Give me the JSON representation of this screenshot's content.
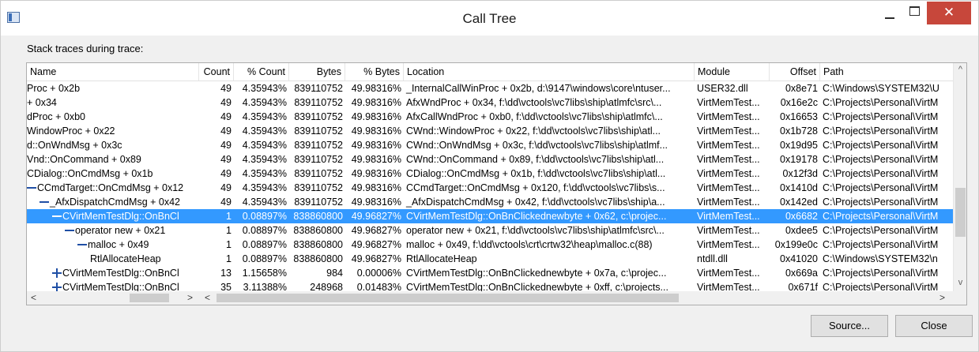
{
  "window": {
    "title": "Call Tree",
    "close_glyph": "✕"
  },
  "caption": "Stack traces during trace:",
  "columns": {
    "name": "Name",
    "count": "Count",
    "pct_count": "% Count",
    "bytes": "Bytes",
    "pct_bytes": "% Bytes",
    "location": "Location",
    "module": "Module",
    "offset": "Offset",
    "path": "Path"
  },
  "rows": [
    {
      "name": "Proc + 0x2b",
      "level": 0,
      "expander": "",
      "count": "49",
      "pct_count": "4.35943%",
      "bytes": "839110752",
      "pct_bytes": "49.98316%",
      "location": "_InternalCallWinProc + 0x2b, d:\\9147\\windows\\core\\ntuser...",
      "module": "USER32.dll",
      "offset": "0x8e71",
      "path": "C:\\Windows\\SYSTEM32\\U"
    },
    {
      "name": "+ 0x34",
      "level": 0,
      "expander": "",
      "count": "49",
      "pct_count": "4.35943%",
      "bytes": "839110752",
      "pct_bytes": "49.98316%",
      "location": "AfxWndProc + 0x34, f:\\dd\\vctools\\vc7libs\\ship\\atlmfc\\src\\...",
      "module": "VirtMemTest...",
      "offset": "0x16e2c",
      "path": "C:\\Projects\\Personal\\VirtM"
    },
    {
      "name": "dProc + 0xb0",
      "level": 0,
      "expander": "",
      "count": "49",
      "pct_count": "4.35943%",
      "bytes": "839110752",
      "pct_bytes": "49.98316%",
      "location": "AfxCallWndProc + 0xb0, f:\\dd\\vctools\\vc7libs\\ship\\atlmfc\\...",
      "module": "VirtMemTest...",
      "offset": "0x16653",
      "path": "C:\\Projects\\Personal\\VirtM"
    },
    {
      "name": "WindowProc + 0x22",
      "level": 0,
      "expander": "",
      "count": "49",
      "pct_count": "4.35943%",
      "bytes": "839110752",
      "pct_bytes": "49.98316%",
      "location": "CWnd::WindowProc + 0x22, f:\\dd\\vctools\\vc7libs\\ship\\atl...",
      "module": "VirtMemTest...",
      "offset": "0x1b728",
      "path": "C:\\Projects\\Personal\\VirtM"
    },
    {
      "name": "d::OnWndMsg + 0x3c",
      "level": 0,
      "expander": "",
      "count": "49",
      "pct_count": "4.35943%",
      "bytes": "839110752",
      "pct_bytes": "49.98316%",
      "location": "CWnd::OnWndMsg + 0x3c, f:\\dd\\vctools\\vc7libs\\ship\\atlmf...",
      "module": "VirtMemTest...",
      "offset": "0x19d95",
      "path": "C:\\Projects\\Personal\\VirtM"
    },
    {
      "name": "Vnd::OnCommand + 0x89",
      "level": 0,
      "expander": "",
      "count": "49",
      "pct_count": "4.35943%",
      "bytes": "839110752",
      "pct_bytes": "49.98316%",
      "location": "CWnd::OnCommand + 0x89, f:\\dd\\vctools\\vc7libs\\ship\\atl...",
      "module": "VirtMemTest...",
      "offset": "0x19178",
      "path": "C:\\Projects\\Personal\\VirtM"
    },
    {
      "name": "CDialog::OnCmdMsg + 0x1b",
      "level": 0,
      "expander": "",
      "count": "49",
      "pct_count": "4.35943%",
      "bytes": "839110752",
      "pct_bytes": "49.98316%",
      "location": "CDialog::OnCmdMsg + 0x1b, f:\\dd\\vctools\\vc7libs\\ship\\atl...",
      "module": "VirtMemTest...",
      "offset": "0x12f3d",
      "path": "C:\\Projects\\Personal\\VirtM"
    },
    {
      "name": "CCmdTarget::OnCmdMsg + 0x12",
      "level": 0,
      "expander": "minus",
      "count": "49",
      "pct_count": "4.35943%",
      "bytes": "839110752",
      "pct_bytes": "49.98316%",
      "location": "CCmdTarget::OnCmdMsg + 0x120, f:\\dd\\vctools\\vc7libs\\s...",
      "module": "VirtMemTest...",
      "offset": "0x1410d",
      "path": "C:\\Projects\\Personal\\VirtM"
    },
    {
      "name": "_AfxDispatchCmdMsg + 0x42",
      "level": 1,
      "expander": "minus",
      "count": "49",
      "pct_count": "4.35943%",
      "bytes": "839110752",
      "pct_bytes": "49.98316%",
      "location": "_AfxDispatchCmdMsg + 0x42, f:\\dd\\vctools\\vc7libs\\ship\\a...",
      "module": "VirtMemTest...",
      "offset": "0x142ed",
      "path": "C:\\Projects\\Personal\\VirtM"
    },
    {
      "name": "CVirtMemTestDlg::OnBnCl",
      "level": 2,
      "expander": "minus",
      "selected": true,
      "count": "1",
      "pct_count": "0.08897%",
      "bytes": "838860800",
      "pct_bytes": "49.96827%",
      "location": "CVirtMemTestDlg::OnBnClickednewbyte + 0x62, c:\\projec...",
      "module": "VirtMemTest...",
      "offset": "0x6682",
      "path": "C:\\Projects\\Personal\\VirtM"
    },
    {
      "name": "operator new + 0x21",
      "level": 3,
      "expander": "minus",
      "count": "1",
      "pct_count": "0.08897%",
      "bytes": "838860800",
      "pct_bytes": "49.96827%",
      "location": "operator new + 0x21, f:\\dd\\vctools\\vc7libs\\ship\\atlmfc\\src\\...",
      "module": "VirtMemTest...",
      "offset": "0xdee5",
      "path": "C:\\Projects\\Personal\\VirtM"
    },
    {
      "name": "malloc + 0x49",
      "level": 4,
      "expander": "minus",
      "count": "1",
      "pct_count": "0.08897%",
      "bytes": "838860800",
      "pct_bytes": "49.96827%",
      "location": "malloc + 0x49, f:\\dd\\vctools\\crt\\crtw32\\heap\\malloc.c(88)",
      "module": "VirtMemTest...",
      "offset": "0x199e0c",
      "path": "C:\\Projects\\Personal\\VirtM"
    },
    {
      "name": "RtlAllocateHeap",
      "level": 5,
      "expander": "",
      "count": "1",
      "pct_count": "0.08897%",
      "bytes": "838860800",
      "pct_bytes": "49.96827%",
      "location": "RtlAllocateHeap",
      "module": "ntdll.dll",
      "offset": "0x41020",
      "path": "C:\\Windows\\SYSTEM32\\n"
    },
    {
      "name": "CVirtMemTestDlg::OnBnCl",
      "level": 2,
      "expander": "plus",
      "count": "13",
      "pct_count": "1.15658%",
      "bytes": "984",
      "pct_bytes": "0.00006%",
      "location": "CVirtMemTestDlg::OnBnClickednewbyte + 0x7a, c:\\projec...",
      "module": "VirtMemTest...",
      "offset": "0x669a",
      "path": "C:\\Projects\\Personal\\VirtM"
    },
    {
      "name": "CVirtMemTestDlg::OnBnCl",
      "level": 2,
      "expander": "plus",
      "count": "35",
      "pct_count": "3.11388%",
      "bytes": "248968",
      "pct_bytes": "0.01483%",
      "location": "CVirtMemTestDlg::OnBnClickednewbyte + 0xff, c:\\projects...",
      "module": "VirtMemTest...",
      "offset": "0x671f",
      "path": "C:\\Projects\\Personal\\VirtM"
    }
  ],
  "scroll": {
    "up": "^",
    "down": "v",
    "left": "<",
    "right": ">"
  },
  "buttons": {
    "source": "Source...",
    "close": "Close"
  }
}
